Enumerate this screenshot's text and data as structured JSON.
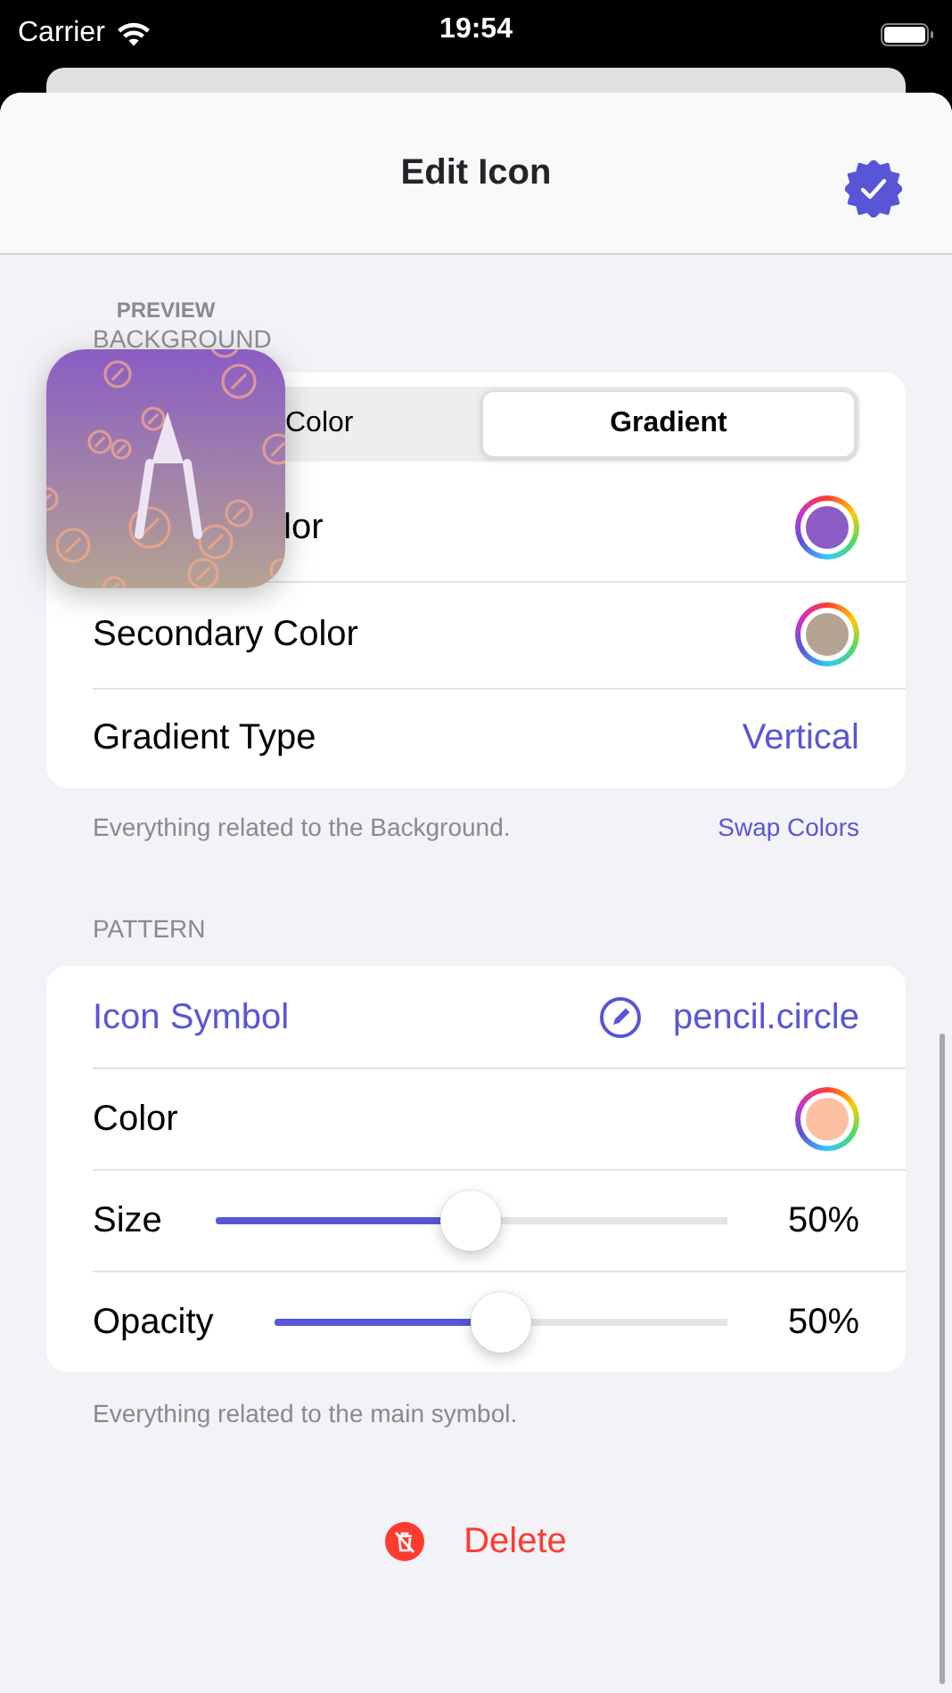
{
  "status_bar": {
    "carrier": "Carrier",
    "time": "19:54"
  },
  "header": {
    "title": "Edit Icon"
  },
  "preview": {
    "label": "PREVIEW"
  },
  "background": {
    "header": "BACKGROUND",
    "segments": [
      {
        "label": "Color",
        "selected": false
      },
      {
        "label": "Gradient",
        "selected": true
      }
    ],
    "rows": [
      {
        "kind": "color",
        "label": "lor",
        "color": "#8a5cc4"
      },
      {
        "kind": "color",
        "label": "Secondary Color",
        "color": "#b5a392"
      },
      {
        "kind": "value",
        "label": "Gradient Type",
        "value": "Vertical"
      }
    ],
    "footer": "Everything related to the Background.",
    "footer_action": "Swap Colors"
  },
  "pattern": {
    "header": "PATTERN",
    "rows": [
      {
        "kind": "symbol",
        "label": "Icon Symbol",
        "value": "pencil.circle"
      },
      {
        "kind": "color",
        "label": "Color",
        "color": "#fcc0a3"
      },
      {
        "kind": "slider",
        "label": "Size",
        "level": 0.5,
        "reading": "50%"
      },
      {
        "kind": "slider",
        "label": "Opacity",
        "level": 0.5,
        "reading": "50%"
      }
    ],
    "footer": "Everything related to the main symbol."
  },
  "delete_button": {
    "label": "Delete"
  }
}
